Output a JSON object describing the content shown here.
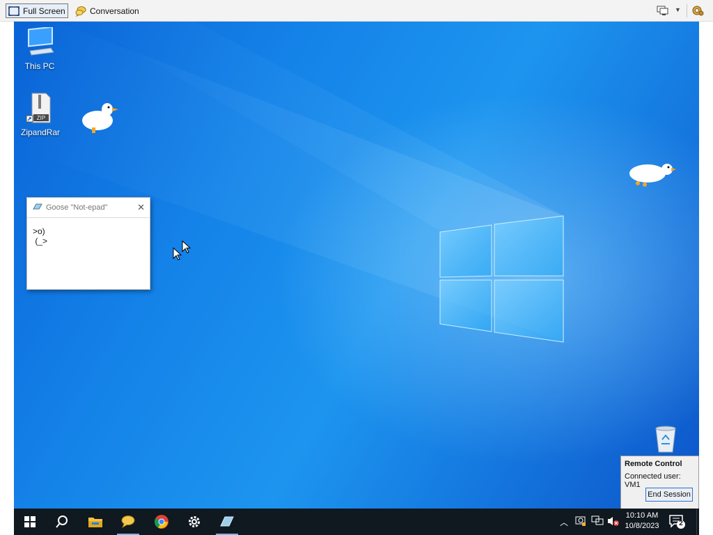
{
  "toolbar": {
    "full_screen_label": "Full Screen",
    "conversation_label": "Conversation"
  },
  "desktop": {
    "icons": [
      {
        "label": "This PC",
        "icon": "this-pc-icon"
      },
      {
        "label": "ZipandRar",
        "icon": "zip-archive-icon",
        "badge": "ZIP"
      }
    ],
    "recycle_bin_icon": "recycle-bin-icon"
  },
  "goose_window": {
    "title": "Goose \"Not-epad\"",
    "text": ">o)\n (_>"
  },
  "remote_control": {
    "title": "Remote Control",
    "connected_user": "Connected user: VM1",
    "end_session_label": "End Session"
  },
  "taskbar": {
    "pinned": [
      "start-icon",
      "search-icon",
      "file-explorer-icon",
      "chat-icon",
      "chrome-icon",
      "settings-icon",
      "notepad-icon"
    ],
    "time": "10:10 AM",
    "date": "10/8/2023",
    "notification_count": "2"
  },
  "colors": {
    "wallpaper_accent": "#1482e8",
    "taskbar": "#101820",
    "end_session_border": "#2c6fd1"
  }
}
